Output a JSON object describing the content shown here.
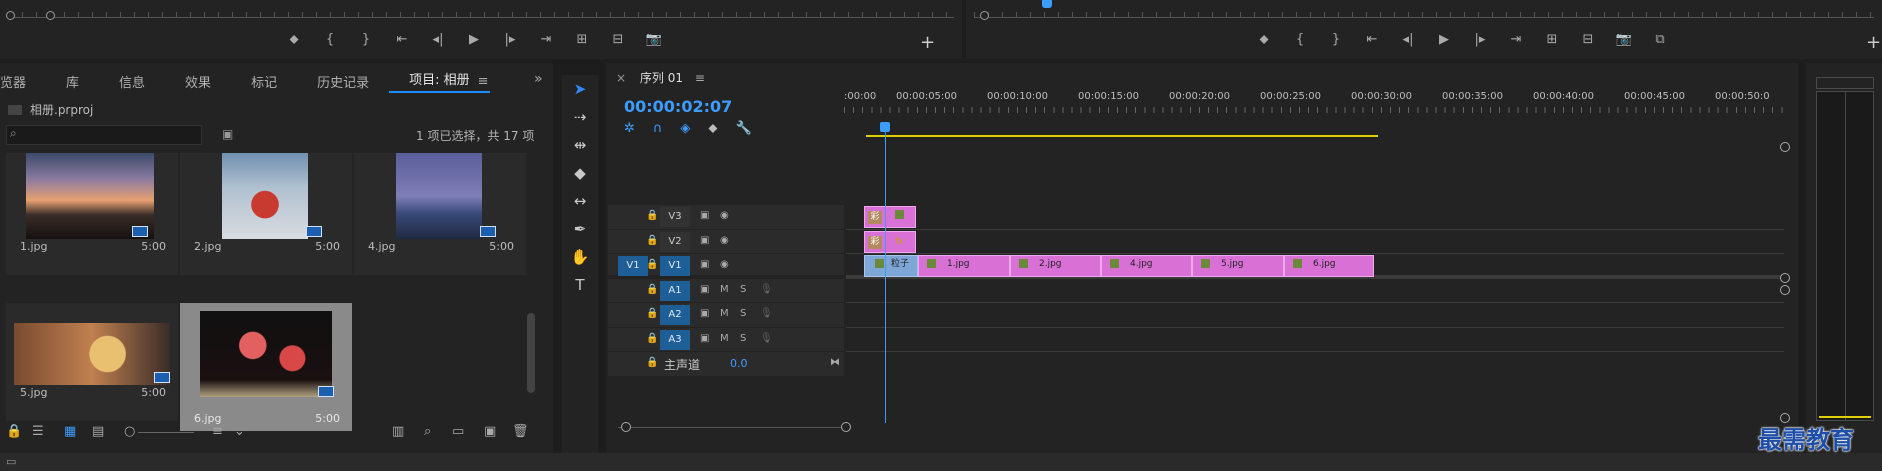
{
  "source_monitor": {
    "controls": [
      "⬥",
      "{",
      "}",
      "⇤",
      "◂|",
      "▶",
      "|▸",
      "⇥",
      "⊞",
      "⊟",
      "📷"
    ],
    "add_label": "+"
  },
  "program_monitor": {
    "controls": [
      "⬥",
      "{",
      "}",
      "⇤",
      "◂|",
      "▶",
      "|▸",
      "⇥",
      "⊞",
      "⊟",
      "📷",
      "⧉"
    ],
    "add_label": "+"
  },
  "project_panel": {
    "tabs": [
      "览器",
      "库",
      "信息",
      "效果",
      "标记",
      "历史记录",
      "项目: 相册"
    ],
    "active_tab": "项目: 相册",
    "tab_menu": "≡",
    "overflow": "»",
    "project_file": "相册.prproj",
    "search_placeholder": "",
    "selection_status": "1 项已选择，共 17 项",
    "items": [
      {
        "name": "1.jpg",
        "duration": "5:00"
      },
      {
        "name": "2.jpg",
        "duration": "5:00"
      },
      {
        "name": "4.jpg",
        "duration": "5:00"
      },
      {
        "name": "5.jpg",
        "duration": "5:00"
      },
      {
        "name": "6.jpg",
        "duration": "5:00"
      }
    ],
    "footer_icons": [
      "🔒",
      "☰",
      "▦",
      "▤",
      "○",
      "≡",
      "⌄",
      "▥",
      "⌕",
      "▭",
      "▣",
      "🗑"
    ]
  },
  "tools": [
    "➤",
    "⇢",
    "⇹",
    "◆",
    "↔",
    "✒",
    "✋",
    "T"
  ],
  "timeline": {
    "tab_close": "×",
    "tab_title": "序列 01",
    "tab_menu": "≡",
    "timecode": "00:00:02:07",
    "ruler_labels": [
      ":00:00",
      "00:00:05:00",
      "00:00:10:00",
      "00:00:15:00",
      "00:00:20:00",
      "00:00:25:00",
      "00:00:30:00",
      "00:00:35:00",
      "00:00:40:00",
      "00:00:45:00",
      "00:00:50:0"
    ],
    "tracks": {
      "V3": "V3",
      "V2": "V2",
      "V1": "V1",
      "V1_src": "V1",
      "A1": "A1",
      "A2": "A2",
      "A3": "A3",
      "master": "主声道",
      "master_volume": "0.0",
      "mute": "M",
      "solo": "S"
    },
    "clips_v1": [
      {
        "label": "粒子",
        "type": "blue"
      },
      {
        "label": "1.jpg"
      },
      {
        "label": "2.jpg"
      },
      {
        "label": "4.jpg"
      },
      {
        "label": "5.jpg"
      },
      {
        "label": "6.jpg"
      }
    ],
    "v3_clip_cap": "彩",
    "v2_clip_cap": "彩",
    "v2_fx": "fx"
  },
  "watermark": "最需教育"
}
